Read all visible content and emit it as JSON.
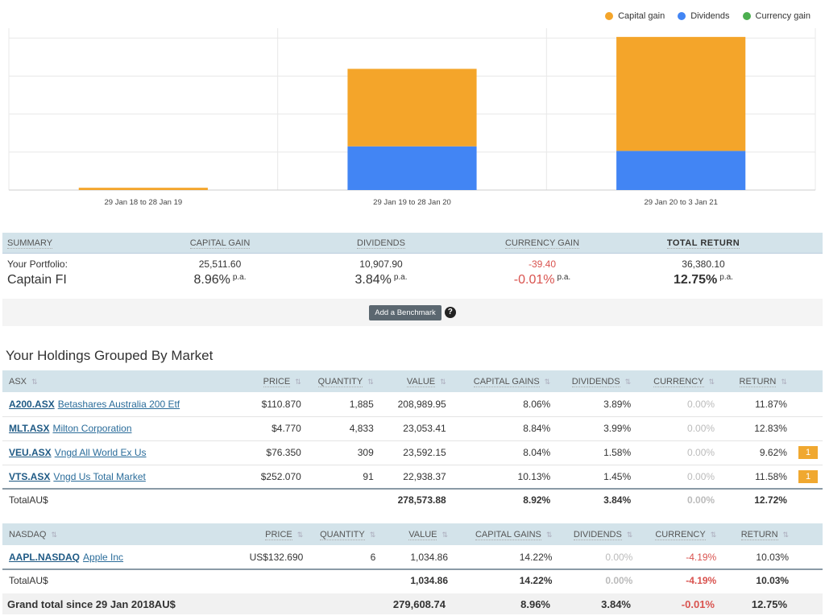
{
  "chart_data": {
    "type": "bar",
    "stacked": true,
    "categories": [
      "29 Jan 18 to 28 Jan 19",
      "29 Jan 19 to 28 Jan 20",
      "29 Jan 20 to 3 Jan 21"
    ],
    "series": [
      {
        "name": "Dividends",
        "color": "#4285f4",
        "values": [
          0,
          5750,
          5150
        ]
      },
      {
        "name": "Capital gain",
        "color": "#f4a52a",
        "values": [
          300,
          10200,
          15000
        ]
      },
      {
        "name": "Currency gain",
        "color": "#4caf50",
        "values": [
          0,
          0,
          0
        ]
      }
    ],
    "ylim": [
      0,
      21300
    ],
    "grid": true,
    "legend": "top-right"
  },
  "legend": [
    {
      "label": "Capital gain",
      "color": "#f4a52a"
    },
    {
      "label": "Dividends",
      "color": "#4285f4"
    },
    {
      "label": "Currency gain",
      "color": "#4caf50"
    }
  ],
  "summary": {
    "headers": [
      "SUMMARY",
      "CAPITAL GAIN",
      "DIVIDENDS",
      "CURRENCY GAIN",
      "TOTAL RETURN"
    ],
    "label": "Your Portfolio:",
    "portfolio": "Captain FI",
    "pa": "p.a.",
    "values": [
      "25,511.60",
      "10,907.90",
      "-39.40",
      "36,380.10"
    ],
    "pcts": [
      "8.96%",
      "3.84%",
      "-0.01%",
      "12.75%"
    ],
    "benchmark_button": "Add a Benchmark",
    "help": "?"
  },
  "holdings_title": "Your Holdings Grouped By Market",
  "columns": [
    "PRICE",
    "QUANTITY",
    "VALUE",
    "CAPITAL GAINS",
    "DIVIDENDS",
    "CURRENCY",
    "RETURN"
  ],
  "markets": [
    {
      "name": "ASX",
      "rows": [
        {
          "code": "A200.ASX",
          "name": "Betashares Australia 200 Etf",
          "price": "$110.870",
          "qty": "1,885",
          "value": "208,989.95",
          "cg": "8.06%",
          "div": "3.89%",
          "cur": "0.00%",
          "ret": "11.87%",
          "badge": ""
        },
        {
          "code": "MLT.ASX",
          "name": "Milton Corporation",
          "price": "$4.770",
          "qty": "4,833",
          "value": "23,053.41",
          "cg": "8.84%",
          "div": "3.99%",
          "cur": "0.00%",
          "ret": "12.83%",
          "badge": ""
        },
        {
          "code": "VEU.ASX",
          "name": "Vngd All World Ex Us",
          "price": "$76.350",
          "qty": "309",
          "value": "23,592.15",
          "cg": "8.04%",
          "div": "1.58%",
          "cur": "0.00%",
          "ret": "9.62%",
          "badge": "1"
        },
        {
          "code": "VTS.ASX",
          "name": "Vngd Us Total Market",
          "price": "$252.070",
          "qty": "91",
          "value": "22,938.37",
          "cg": "10.13%",
          "div": "1.45%",
          "cur": "0.00%",
          "ret": "11.58%",
          "badge": "1"
        }
      ],
      "total": {
        "label": "TotalAU$",
        "value": "278,573.88",
        "cg": "8.92%",
        "div": "3.84%",
        "cur": "0.00%",
        "ret": "12.72%"
      }
    },
    {
      "name": "NASDAQ",
      "rows": [
        {
          "code": "AAPL.NASDAQ",
          "name": "Apple Inc",
          "price": "US$132.690",
          "qty": "6",
          "value": "1,034.86",
          "cg": "14.22%",
          "div": "0.00%",
          "cur": "-4.19%",
          "ret": "10.03%",
          "badge": ""
        }
      ],
      "total": {
        "label": "TotalAU$",
        "value": "1,034.86",
        "cg": "14.22%",
        "div": "0.00%",
        "cur": "-4.19%",
        "ret": "10.03%"
      }
    }
  ],
  "grand": {
    "label": "Grand total since 29 Jan 2018AU$",
    "value": "279,608.74",
    "cg": "8.96%",
    "div": "3.84%",
    "cur": "-0.01%",
    "ret": "12.75%"
  }
}
